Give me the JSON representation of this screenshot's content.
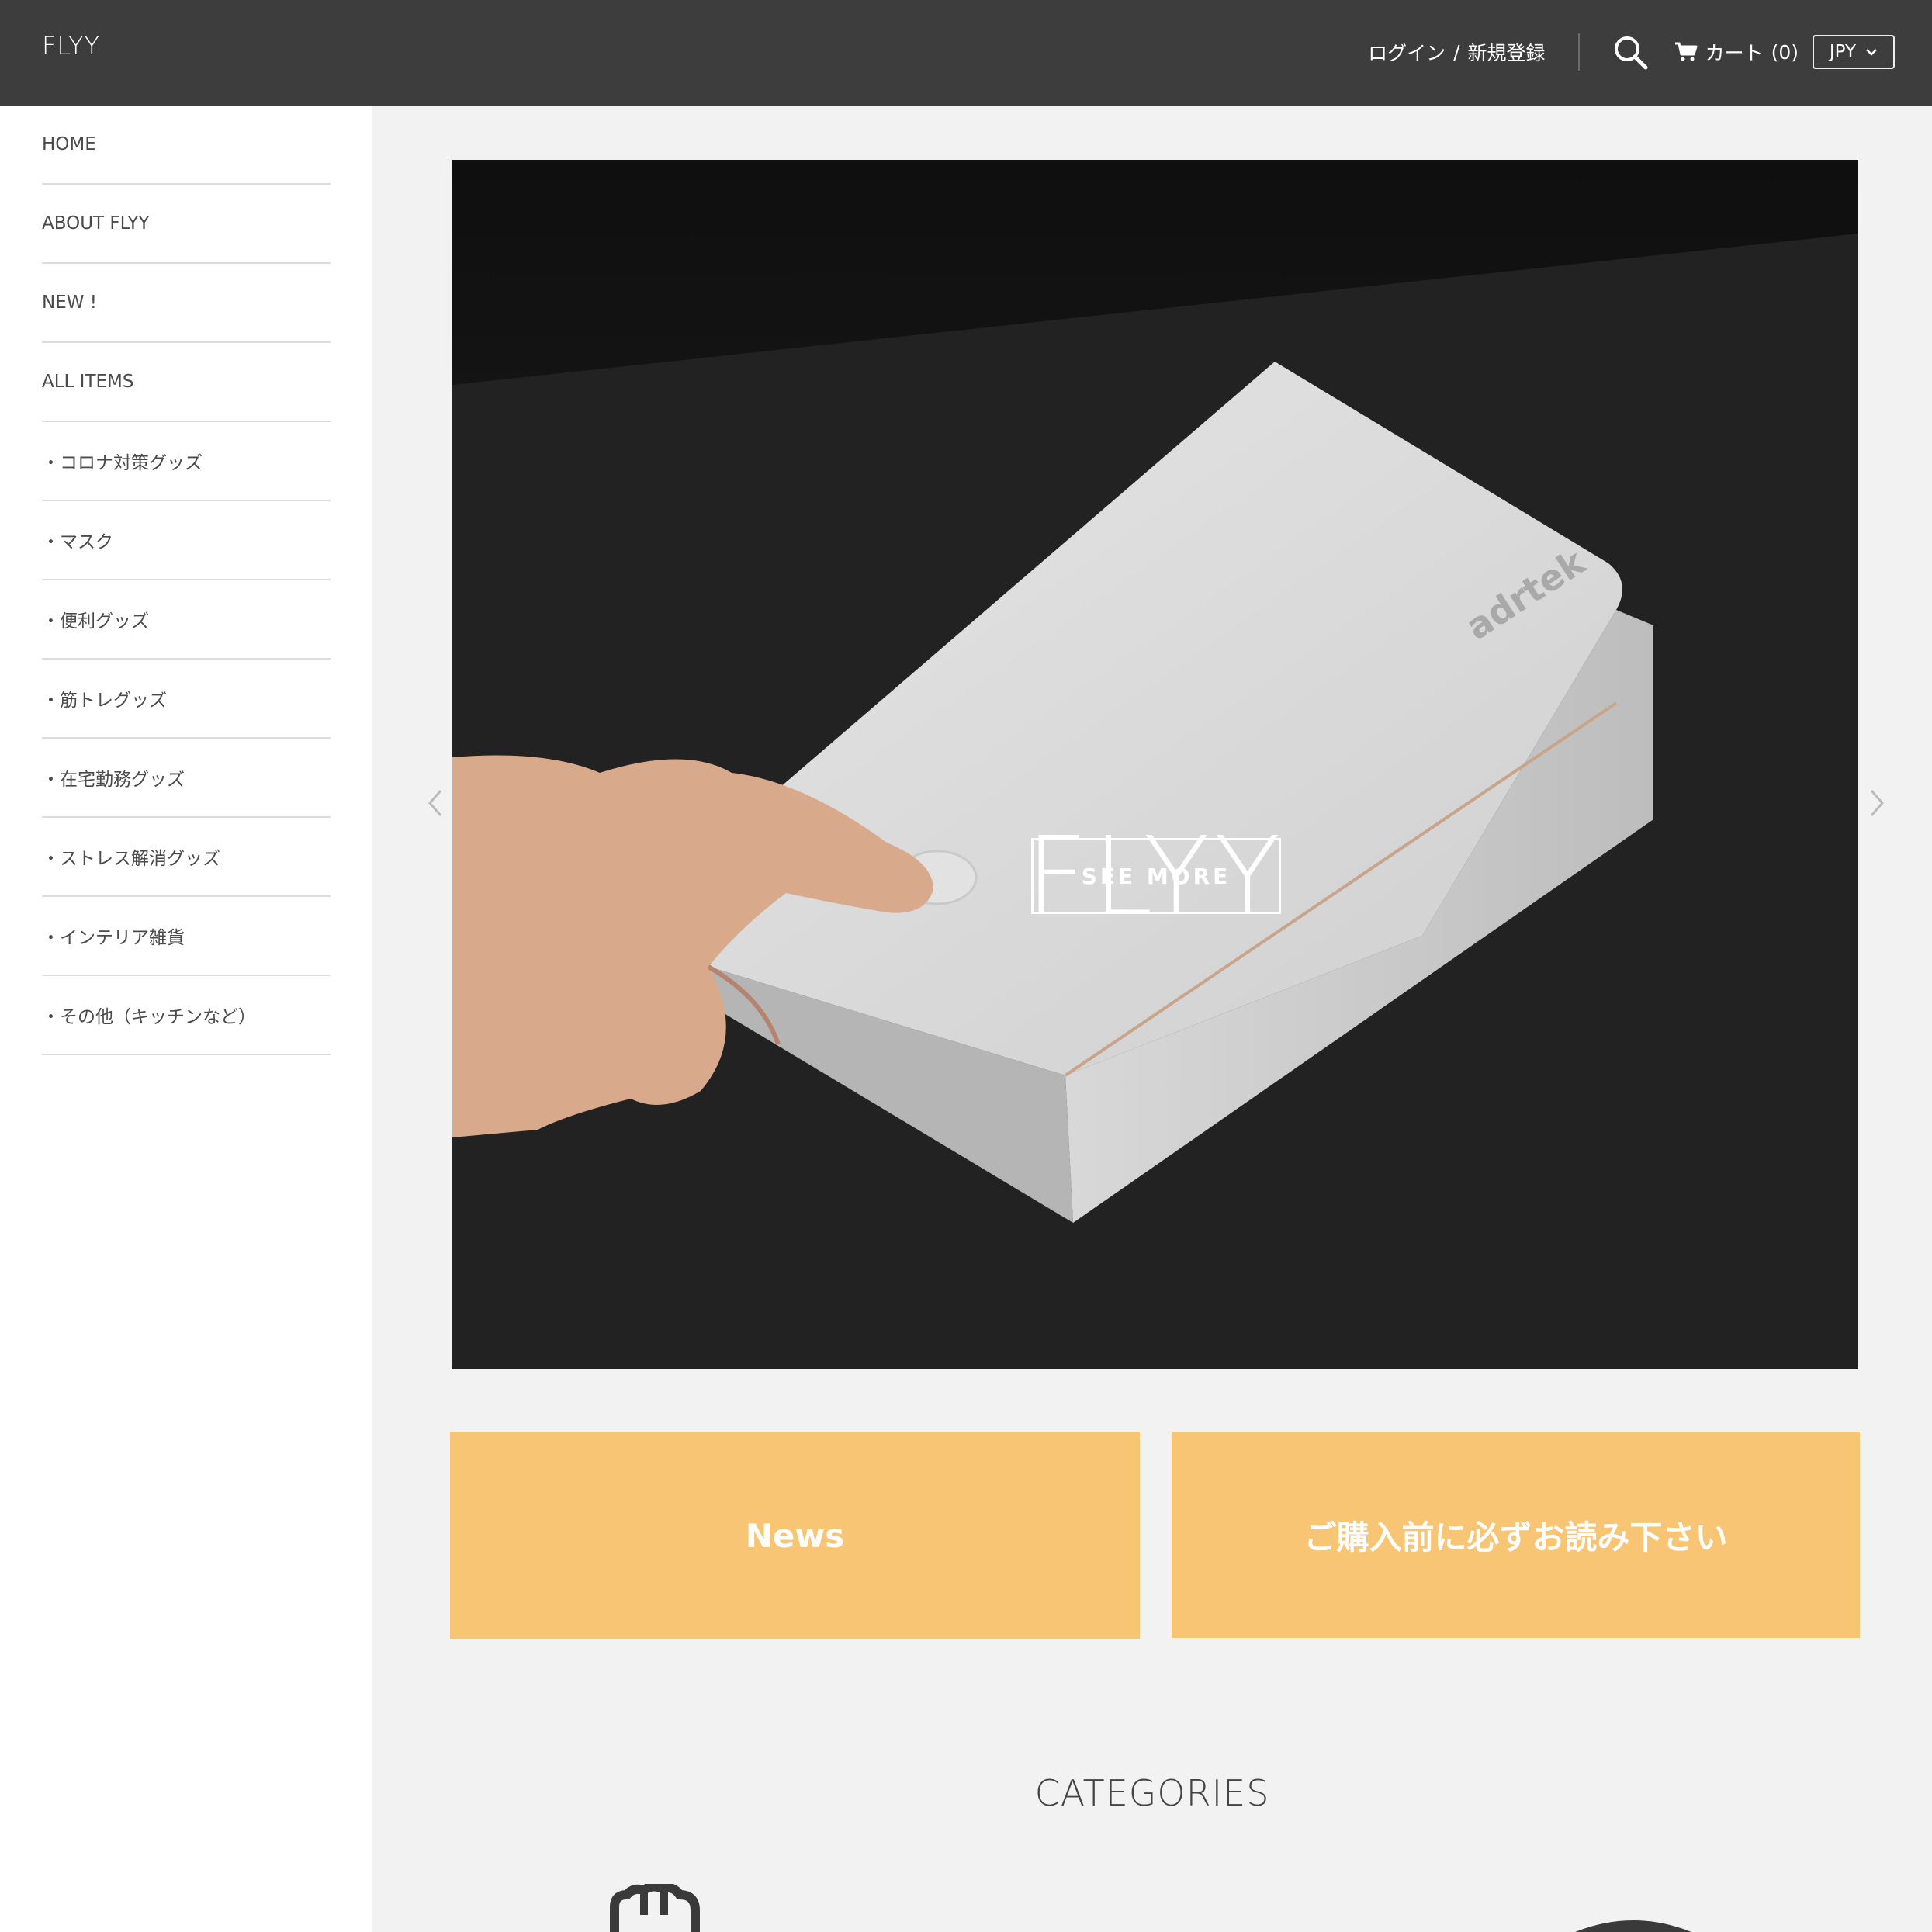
{
  "header": {
    "brand": "FLYY",
    "login": "ログイン",
    "separator": "/",
    "register": "新規登録",
    "cart_label": "カート",
    "cart_count": "(0)",
    "currency": "JPY"
  },
  "sidebar": {
    "items": [
      {
        "label": "HOME"
      },
      {
        "label": "ABOUT FLYY"
      },
      {
        "label": "NEW !"
      },
      {
        "label": "ALL ITEMS"
      },
      {
        "label": "・コロナ対策グッズ"
      },
      {
        "label": "・マスク"
      },
      {
        "label": "・便利グッズ"
      },
      {
        "label": "・筋トレグッズ"
      },
      {
        "label": "・在宅勤務グッズ"
      },
      {
        "label": "・ストレス解消グッズ"
      },
      {
        "label": "・インテリア雑貨"
      },
      {
        "label": "・その他（キッチンなど）"
      }
    ]
  },
  "hero": {
    "title": "FLYY",
    "button": "SEE MORE",
    "product_brand": "adrtek"
  },
  "banners": {
    "news": "News",
    "read_before": "ご購入前に必ずお読み下さい"
  },
  "categories": {
    "title": "CATEGORIES"
  },
  "colors": {
    "header_bg": "#3d3d3d",
    "banner_bg": "#f7c574",
    "page_bg": "#f2f2f2"
  }
}
